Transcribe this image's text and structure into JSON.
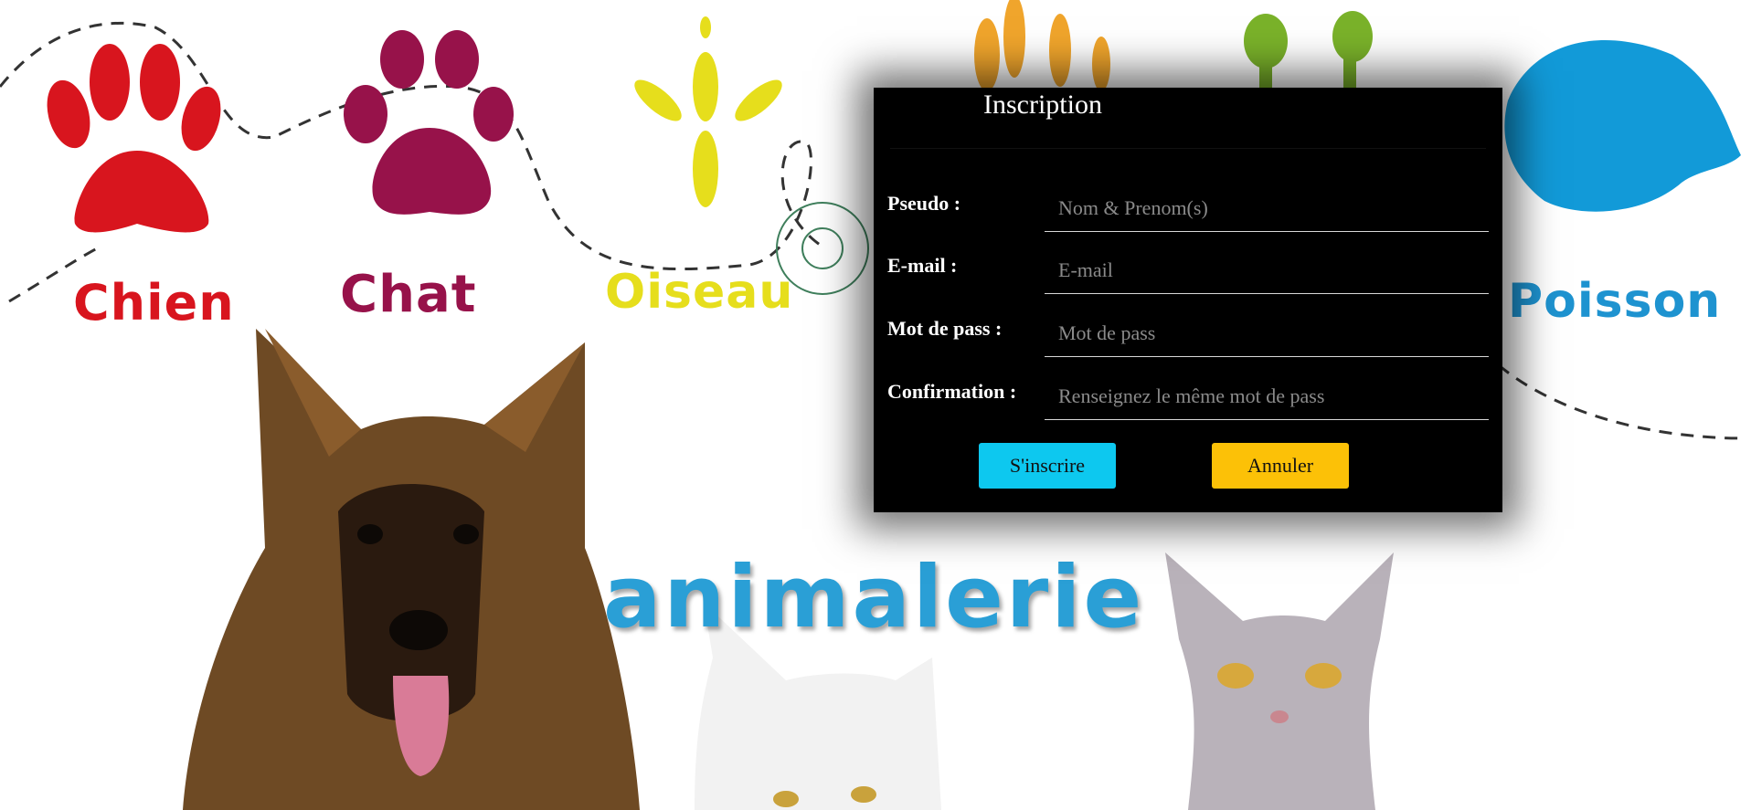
{
  "background": {
    "labels": {
      "chien": "Chien",
      "chat": "Chat",
      "oiseau": "Oiseau",
      "poisson": "Poisson",
      "brand": "animalerie"
    },
    "colors": {
      "chien": "#d8151e",
      "chat": "#97124a",
      "oiseau": "#e6de1c",
      "poisson": "#1e93d0",
      "brand": "#2a9fd6"
    }
  },
  "modal": {
    "title": "Inscription",
    "fields": [
      {
        "label": "Pseudo :",
        "placeholder": "Nom & Prenom(s)",
        "value": ""
      },
      {
        "label": "E-mail :",
        "placeholder": "E-mail",
        "value": ""
      },
      {
        "label": "Mot de pass :",
        "placeholder": "Mot de pass",
        "value": ""
      },
      {
        "label": "Confirmation :",
        "placeholder": "Renseignez le même mot de pass",
        "value": ""
      }
    ],
    "buttons": {
      "submit": "S'inscrire",
      "cancel": "Annuler"
    },
    "colors": {
      "background": "#000000",
      "submit": "#0dc8ef",
      "cancel": "#fcc107"
    }
  }
}
